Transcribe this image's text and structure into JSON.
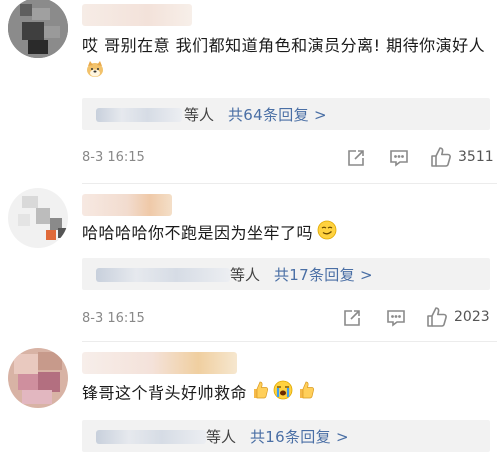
{
  "comments": [
    {
      "text": "哎 哥别在意 我们都知道角色和演员分离! 期待你演好人",
      "emoji": "doge-face-icon",
      "reply": {
        "who": "等人",
        "more": "共64条回复 >"
      },
      "time": "8-3 16:15",
      "likes": "3511"
    },
    {
      "text": "哈哈哈哈你不跑是因为坐牢了吗",
      "emoji": "smirk-face-icon",
      "reply": {
        "who": "等人",
        "more": "共17条回复 >"
      },
      "time": "8-3 16:15",
      "likes": "2023"
    },
    {
      "text": "锋哥这个背头好帅救命",
      "emoji": "thumbs-up-cry-thumbs-up-icons",
      "reply": {
        "who": "等人",
        "more": "共16条回复 >"
      }
    }
  ],
  "colors": {
    "link": "#4a6fa5",
    "meta": "#888888",
    "reply_bg": "#f2f2f2"
  }
}
